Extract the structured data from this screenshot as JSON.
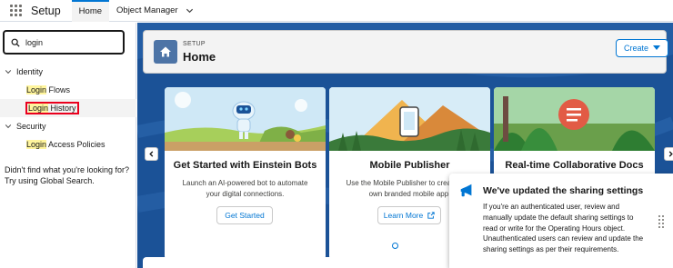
{
  "topbar": {
    "app_name": "Setup",
    "tabs": [
      {
        "label": "Home"
      },
      {
        "label": "Object Manager"
      }
    ]
  },
  "sidebar": {
    "search_value": "login",
    "tree": {
      "identity": {
        "label": "Identity",
        "items": [
          {
            "match": "Login",
            "rest": " Flows"
          },
          {
            "match": "Login",
            "rest": " History"
          }
        ]
      },
      "security": {
        "label": "Security",
        "items": [
          {
            "match": "Login",
            "rest": " Access Policies"
          }
        ]
      }
    },
    "no_results": {
      "line1": "Didn't find what you're looking for?",
      "line2": "Try using Global Search."
    }
  },
  "header": {
    "eyebrow": "SETUP",
    "title": "Home",
    "create_label": "Create"
  },
  "cards": [
    {
      "title": "Get Started with Einstein Bots",
      "description": "Launch an AI-powered bot to automate your digital connections.",
      "button": "Get Started"
    },
    {
      "title": "Mobile Publisher",
      "description": "Use the Mobile Publisher to create your own branded mobile app.",
      "button": "Learn More"
    },
    {
      "title": "Real-time Collaborative Docs",
      "description": "",
      "button": ""
    }
  ],
  "carousel": {
    "pages": 3,
    "active_page": 1
  },
  "popover": {
    "title": "We've updated the sharing settings",
    "body": "If you're an authenticated user, review and manually update the default sharing settings to read or write for the Operating Hours object. Unauthenticated users can review and update the sharing settings as per their requirements."
  },
  "colors": {
    "brand_blue": "#0176d3",
    "main_background": "#1b5297",
    "highlight": "#fff59d",
    "selection_outline": "#ea001e"
  }
}
